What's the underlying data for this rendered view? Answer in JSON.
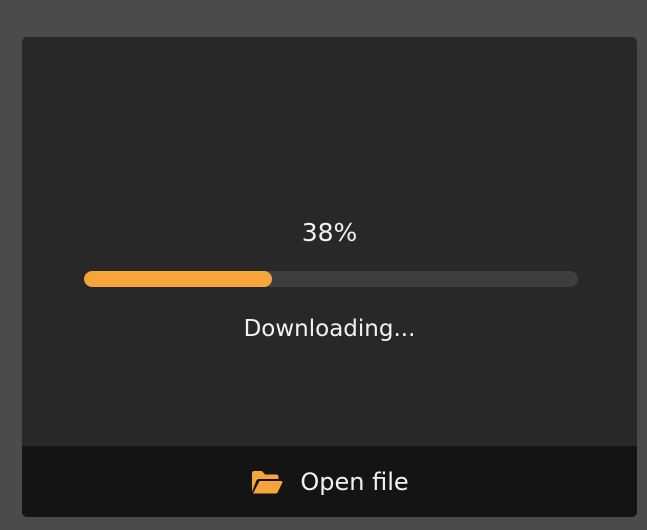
{
  "progress": {
    "percent_label": "38%",
    "fraction": 0.38,
    "status": "Downloading..."
  },
  "footer": {
    "open_file_label": "Open file",
    "icon": "folder-open-icon"
  },
  "colors": {
    "accent": "#f6a53a",
    "panel": "#282828",
    "footer": "#141414",
    "background": "#4b4b4b"
  }
}
